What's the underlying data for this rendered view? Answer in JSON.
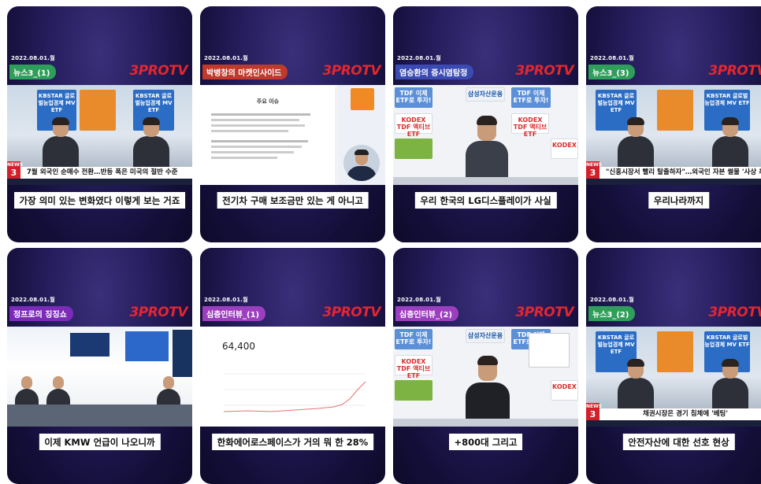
{
  "cards": [
    {
      "date": "2022.08.01.월",
      "tag": "뉴스3_(1)",
      "tag_color": "#2f9e5b",
      "logo": "3PROTV",
      "caption": "가장 의미 있는 변화였다 이렇게 보는 거죠",
      "headline": "7월 외국인 순매수 전환…반등 폭은 미국의 절반 수준",
      "news_label": "NEWS"
    },
    {
      "date": "2022.08.01.월",
      "tag": "박병창의 마켓인사이드",
      "tag_color": "#c0392b",
      "logo": "3PROTV",
      "caption": "전기차 구매 보조금만 있는 게 아니고",
      "slide_title": "주요 이슈"
    },
    {
      "date": "2022.08.01.월",
      "tag": "염승환의 증시염탐정",
      "tag_color": "#3b4bb3",
      "logo": "3PROTV",
      "caption": "우리 한국의 LG디스플레이가 사실"
    },
    {
      "date": "2022.08.01.월",
      "tag": "뉴스3_(3)",
      "tag_color": "#2f9e5b",
      "logo": "3PROTV",
      "caption": "우리나라까지",
      "headline": "\"신흥시장서 빨리 탈출하자\"…외국인 자본 썰물 '사상 최장'",
      "news_label": "NEWS"
    },
    {
      "date": "2022.08.01.월",
      "tag": "정프로의 징징쇼",
      "tag_color": "#7b2bb8",
      "logo": "3PROTV",
      "caption": "이제 KMW 언급이 나오니까"
    },
    {
      "date": "2022.08.01.월",
      "tag": "심층인터뷰_(1)",
      "tag_color": "#9b3fbf",
      "logo": "3PROTV",
      "caption": "한화에어로스페이스가 거의 뭐 한 28%",
      "price": "64,400"
    },
    {
      "date": "2022.08.01.월",
      "tag": "심층인터뷰_(2)",
      "tag_color": "#9b3fbf",
      "logo": "3PROTV",
      "caption": "+800대 그리고"
    },
    {
      "date": "2022.08.01.월",
      "tag": "뉴스3_(2)",
      "tag_color": "#2f9e5b",
      "logo": "3PROTV",
      "caption": "안전자산에 대한 선호 현상",
      "headline": "채권시장은 경기 침체에 '베팅'",
      "news_label": "NEWS"
    }
  ],
  "posters": {
    "kbstar": "KBSTAR 글로벌능업경제 MV ETF",
    "kb": "KB자산운용",
    "tdf": "TDF 이제 ETF로 투자!",
    "kodex_tdf": "KODEX TDF 액티브 ETF",
    "samsung": "삼성자산운용",
    "kodex": "KODEX"
  }
}
